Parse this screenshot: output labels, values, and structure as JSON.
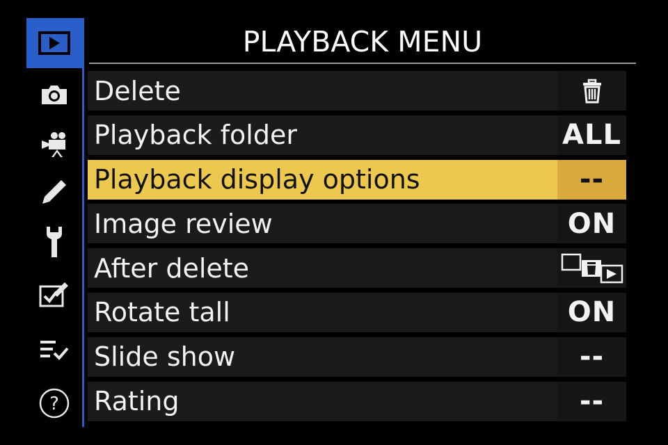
{
  "title": "PLAYBACK MENU",
  "tabs": [
    {
      "icon": "playback-icon",
      "active": true
    },
    {
      "icon": "camera-icon",
      "active": false
    },
    {
      "icon": "movie-camera-icon",
      "active": false
    },
    {
      "icon": "pencil-icon",
      "active": false
    },
    {
      "icon": "wrench-icon",
      "active": false
    },
    {
      "icon": "retouch-icon",
      "active": false
    },
    {
      "icon": "my-menu-icon",
      "active": false
    },
    {
      "icon": "help-icon",
      "active": false
    }
  ],
  "menu": {
    "items": [
      {
        "label": "Delete",
        "value": "",
        "value_icon": "trash-icon"
      },
      {
        "label": "Playback folder",
        "value": "ALL"
      },
      {
        "label": "Playback display options",
        "value": "--",
        "selected": true
      },
      {
        "label": "Image review",
        "value": "ON"
      },
      {
        "label": "After delete",
        "value": "",
        "value_icon": "after-delete-icon"
      },
      {
        "label": "Rotate tall",
        "value": "ON"
      },
      {
        "label": "Slide show",
        "value": "--"
      },
      {
        "label": "Rating",
        "value": "--"
      }
    ]
  },
  "colors": {
    "accent_blue": "#2a5ec9",
    "selected_row": "#ecc84e",
    "selected_value": "#d9a93b",
    "row_bg": "#1b1b1b"
  }
}
